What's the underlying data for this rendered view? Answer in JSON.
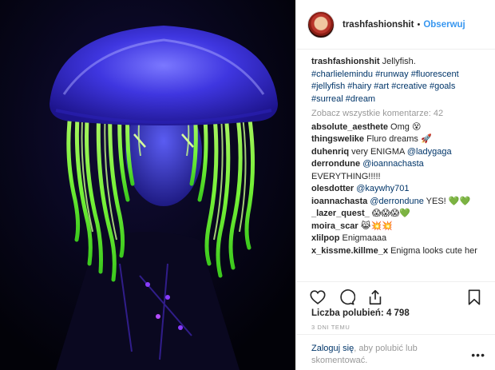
{
  "post": {
    "username": "trashfashionshit",
    "dot": "•",
    "follow_label": "Obserwuj"
  },
  "caption": {
    "username": "trashfashionshit",
    "text": "Jellyfish.",
    "tags_line1": "#charlielemindu #runway #fluorescent",
    "tags_line2": "#jellyfish #hairy #art #creative #goals",
    "tags_line3": "#surreal #dream"
  },
  "view_all_comments": "Zobacz wszystkie komentarze: 42",
  "comments": [
    {
      "user": "absolute_aesthete",
      "text": "Omg 😵",
      "mention": ""
    },
    {
      "user": "thingswelike",
      "text": "Fluro dreams 🚀",
      "mention": ""
    },
    {
      "user": "duhenriq",
      "text": "very ENIGMA ",
      "mention": "@ladygaga"
    },
    {
      "user": "derrondune",
      "text": "",
      "mention": "@ioannachasta"
    },
    {
      "user": "",
      "text": "EVERYTHING!!!!!",
      "mention": ""
    },
    {
      "user": "olesdotter",
      "text": "",
      "mention": "@kaywhy701"
    },
    {
      "user": "ioannachasta",
      "text": " YES! 💚💚",
      "mention": "@derrondune"
    },
    {
      "user": "_lazer_quest_",
      "text": "😱😱😱💚",
      "mention": ""
    },
    {
      "user": "moira_scar",
      "text": "😹💥💥",
      "mention": ""
    },
    {
      "user": "xlilpop",
      "text": "Enigmaaaa",
      "mention": ""
    },
    {
      "user": "x_kissme.killme_x",
      "text": "Enigma looks cute her",
      "mention": ""
    }
  ],
  "icons": {
    "like": "heart-icon",
    "comment": "comment-icon",
    "share": "share-icon",
    "save": "bookmark-icon",
    "more": "more-icon"
  },
  "likes": {
    "label": "Liczba polubień:",
    "count": "4 798"
  },
  "date": "3 DNI TEMU",
  "footer": {
    "login_label": "Zaloguj się",
    "rest_text": ", aby polubić lub skomentować.",
    "more_label": "•••"
  },
  "colors": {
    "link_blue": "#3897f0",
    "tag_blue": "#003569",
    "muted": "#999999",
    "jelly_blue": "#3b34d8",
    "jelly_green": "#7dff3a"
  }
}
